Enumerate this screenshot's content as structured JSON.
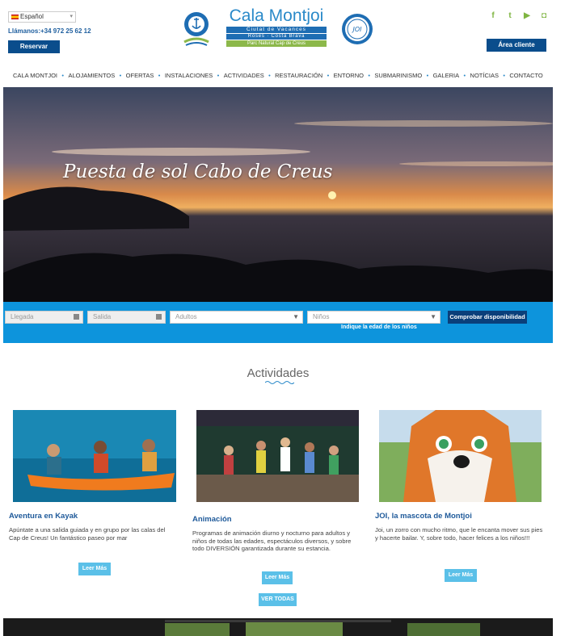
{
  "header": {
    "language": "Español",
    "phone": "Llámanos:+34 972 25 62 12",
    "reserve_label": "Reservar",
    "client_area_label": "Área cliente",
    "brand_name": "Cala Montjoi",
    "brand_subtitle": "Ciutat de Vacances",
    "brand_location": "Roses · Costa Brava",
    "brand_tagline": "Parc Natural Cap de Creus",
    "badge_text": "JOI"
  },
  "nav": [
    "CALA MONTJOI",
    "ALOJAMIENTOS",
    "OFERTAS",
    "INSTALACIONES",
    "ACTIVIDADES",
    "RESTAURACIÓN",
    "ENTORNO",
    "SUBMARINISMO",
    "GALERIA",
    "NOTÍCIAS",
    "CONTACTO"
  ],
  "hero": {
    "title": "Puesta de sol Cabo de Creus"
  },
  "booking": {
    "arrival": "Llegada",
    "departure": "Salida",
    "adults": "Adultos",
    "children": "Niños",
    "check_label": "Comprobar disponibilidad",
    "kids_note": "Indique la edad de los niños"
  },
  "activities": {
    "title": "Actividades",
    "cards": [
      {
        "title": "Aventura en Kayak",
        "text": "Apúntate a una salida guiada y en grupo por las calas del Cap de Creus! Un fantástico paseo por mar",
        "button": "Leer Más"
      },
      {
        "title": "Animación",
        "text": "Programas de animación diurno y nocturno para adultos y niños de todas las edades, espectáculos diversos, y sobre todo DIVERSIÓN garantizada durante su estancia.",
        "button": "Leer Más"
      },
      {
        "title": "JOI, la mascota de Montjoi",
        "text": "Joi, un zorro con mucho ritmo, que le encanta mover sus pies y hacerte bailar. Y, sobre todo, hacer felices a los niños!!!",
        "button": "Leer Más"
      }
    ],
    "see_all": "VER TODAS"
  },
  "social_icons": [
    "facebook-icon",
    "twitter-icon",
    "youtube-icon",
    "instagram-icon"
  ],
  "colors": {
    "brand_blue": "#0a4d8c",
    "accent_blue": "#0d94dc",
    "light_button": "#5bc0e8",
    "social_green": "#7fb542"
  }
}
